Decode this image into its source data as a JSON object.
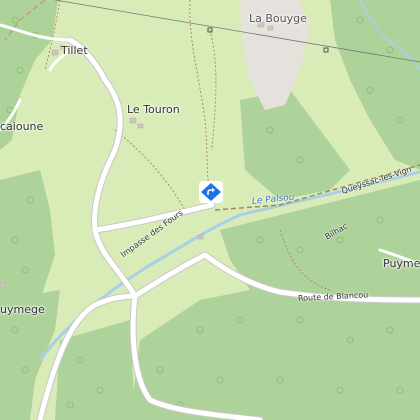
{
  "map": {
    "places": {
      "la_bouyge": "La Bouyge",
      "tillet": "Tillet",
      "le_touron": "Le Touron",
      "caioune": "caioune",
      "puyme": "Puyme",
      "uymege": "uymege"
    },
    "roads": {
      "impasse_des_fours": "Impasse des Fours",
      "route_de_blancou": "Route de Blancou",
      "queyssac": "Queyssac-les-Vign",
      "bilhac": "Bilhac"
    },
    "water": {
      "le_palsou": "Le Palsou"
    },
    "marker": {
      "icon": "directions-diamond-icon",
      "color": "#1a73e8"
    },
    "colors": {
      "meadow": "#d9ecb7",
      "forest": "#aed39a",
      "road": "#ffffff",
      "water": "#a8cfe8",
      "residential": "#e5e1dc"
    }
  }
}
